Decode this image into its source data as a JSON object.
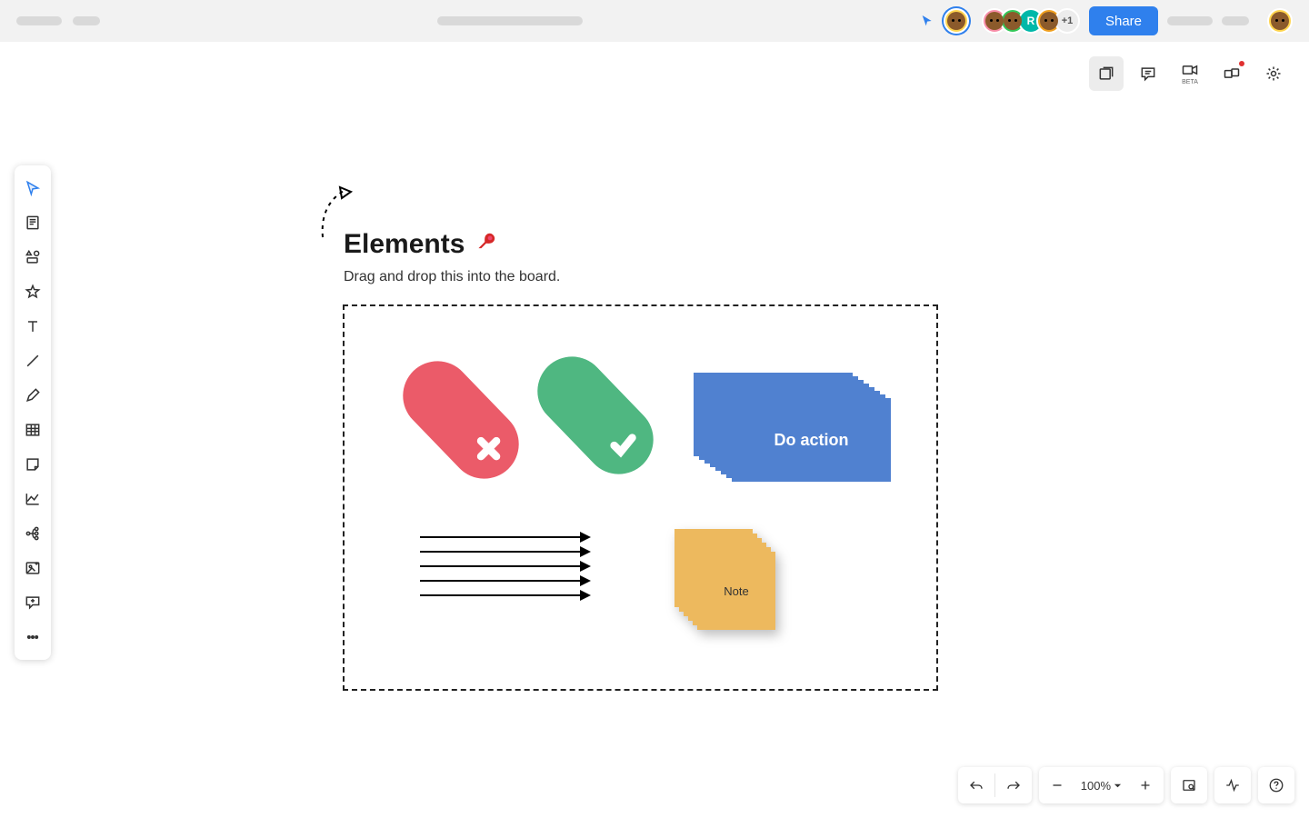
{
  "topbar": {
    "share_label": "Share",
    "overflow_count": "+1"
  },
  "right_controls": {
    "beta_label": "BETA"
  },
  "canvas": {
    "title": "Elements",
    "subtitle": "Drag and drop this into the board.",
    "blue_card_label": "Do action",
    "note_label": "Note",
    "arrow_count": 5,
    "blue_card_stack_count": 8,
    "note_stack_count": 6
  },
  "bottombar": {
    "zoom_label": "100%"
  },
  "colors": {
    "accent_blue": "#2f80ed",
    "pill_red": "#eb5b69",
    "pill_green": "#4fb781",
    "card_blue": "#5081d0",
    "note_orange": "#edb95e"
  }
}
